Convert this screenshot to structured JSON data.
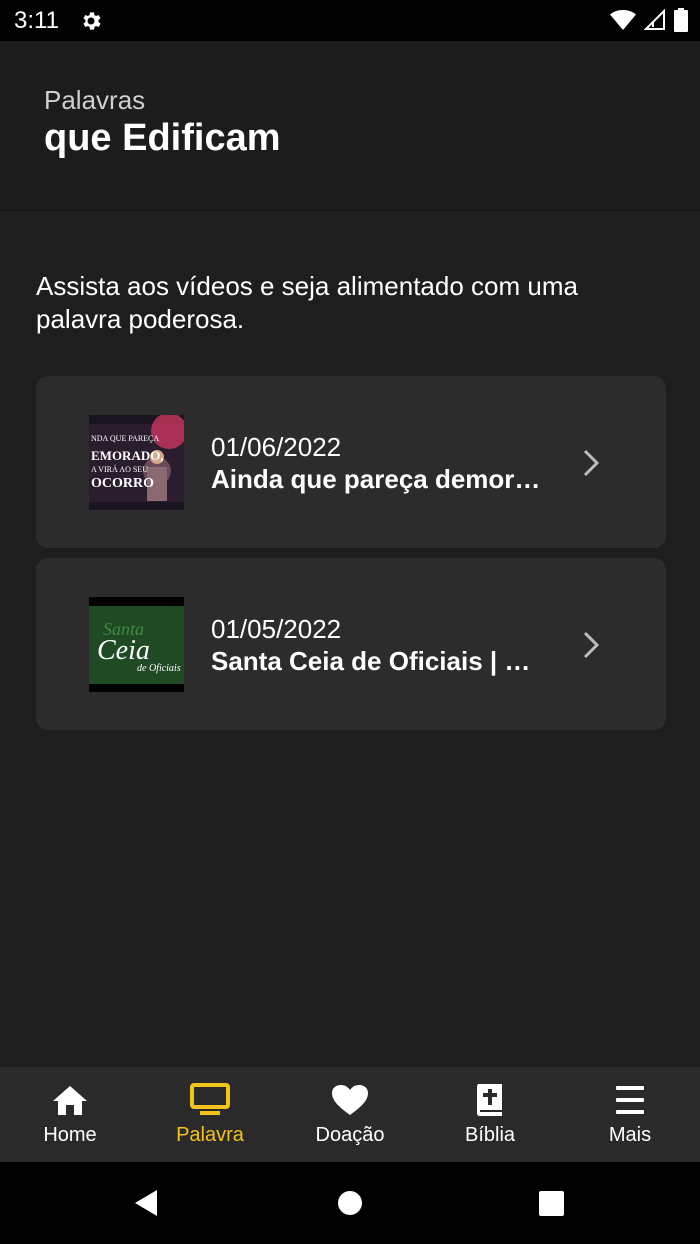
{
  "status": {
    "time": "3:11"
  },
  "header": {
    "subtitle": "Palavras",
    "title": "que Edificam"
  },
  "intro": "Assista aos vídeos e seja alimentado com uma palavra poderosa.",
  "videos": [
    {
      "date": "01/06/2022",
      "title": "Ainda que pareça demora...",
      "thumb_lines": [
        "NDA QUE PAREÇA",
        "EMORADO,",
        "A VIRÁ AO SEU",
        "OCORRO"
      ]
    },
    {
      "date": "01/05/2022",
      "title": "Santa Ceia de Oficiais | M...",
      "thumb_lines": [
        "Santa",
        "Ceia",
        "de Oficiais"
      ]
    }
  ],
  "nav": [
    {
      "label": "Home",
      "icon": "home-icon"
    },
    {
      "label": "Palavra",
      "icon": "monitor-icon",
      "active": true
    },
    {
      "label": "Doação",
      "icon": "heart-icon"
    },
    {
      "label": "Bíblia",
      "icon": "bible-icon"
    },
    {
      "label": "Mais",
      "icon": "menu-icon"
    }
  ],
  "colors": {
    "accent": "#f2c31a",
    "background": "#1e1e1e",
    "card": "#2c2c2c"
  }
}
